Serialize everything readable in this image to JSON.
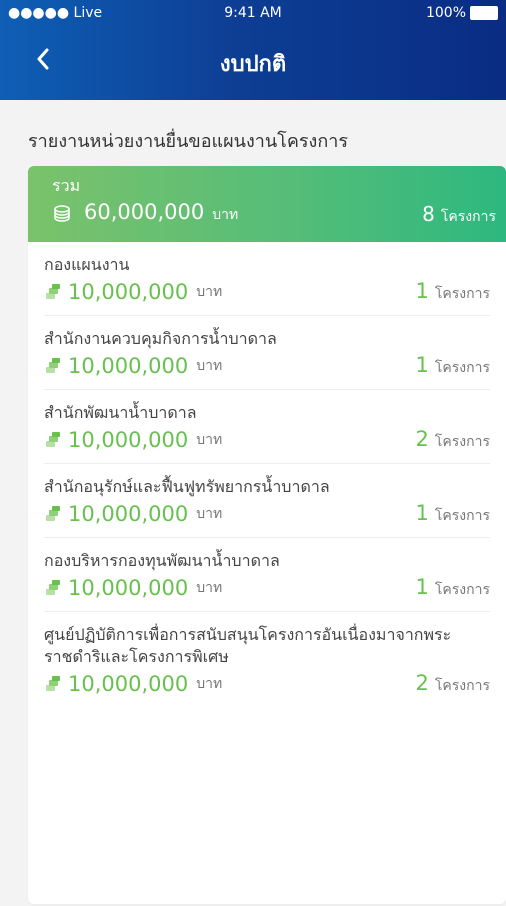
{
  "status_bar": {
    "carrier": "●●●●● Live",
    "time": "9:41 AM",
    "battery": "100%"
  },
  "header": {
    "title": "งบปกติ",
    "back_icon": "chevron-left-icon"
  },
  "section_title": "รายงานหน่วยงานยื่นขอแผนงานโครงการ",
  "total": {
    "label": "รวม",
    "amount": "60,000,000",
    "unit": "บาท",
    "count": "8",
    "count_unit": "โครงการ",
    "icon": "coin-stack-icon"
  },
  "items": [
    {
      "title": "กองแผนงาน",
      "amount": "10,000,000",
      "unit": "บาท",
      "count": "1",
      "count_unit": "โครงการ"
    },
    {
      "title": "สำนักงานควบคุมกิจการน้ำบาดาล",
      "amount": "10,000,000",
      "unit": "บาท",
      "count": "1",
      "count_unit": "โครงการ"
    },
    {
      "title": "สำนักพัฒนาน้ำบาดาล",
      "amount": "10,000,000",
      "unit": "บาท",
      "count": "2",
      "count_unit": "โครงการ"
    },
    {
      "title": "สำนักอนุรักษ์และฟื้นฟูทรัพยากรน้ำบาดาล",
      "amount": "10,000,000",
      "unit": "บาท",
      "count": "1",
      "count_unit": "โครงการ"
    },
    {
      "title": "กองบริหารกองทุนพัฒนาน้ำบาดาล",
      "amount": "10,000,000",
      "unit": "บาท",
      "count": "1",
      "count_unit": "โครงการ"
    },
    {
      "title": "ศูนย์ปฏิบัติการเพื่อการสนับสนุนโครงการอันเนื่องมาจากพระราชดำริและโครงการพิเศษ",
      "amount": "10,000,000",
      "unit": "บาท",
      "count": "2",
      "count_unit": "โครงการ"
    }
  ],
  "colors": {
    "header": "#0d3f95",
    "green": "#68c14f",
    "total_gradient_start": "#7bc26b",
    "total_gradient_end": "#2db87f"
  }
}
